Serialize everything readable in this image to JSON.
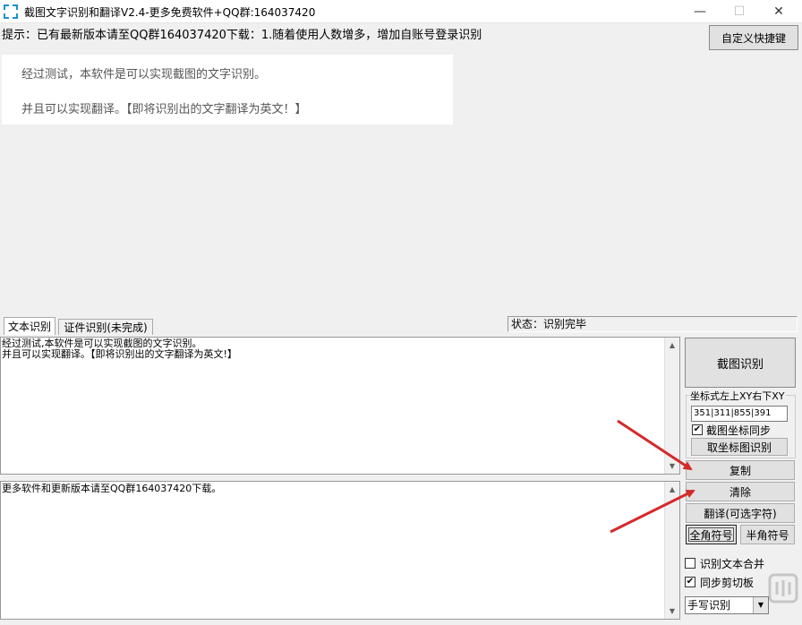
{
  "window": {
    "title": "截图文字识别和翻译V2.4-更多免费软件+QQ群:164037420",
    "min_glyph": "—",
    "max_glyph": "☐",
    "close_glyph": "✕"
  },
  "hint": "提示：已有最新版本请至QQ群164037420下载：1.随着使用人数增多，增加自账号登录识别",
  "shortcut_button": "自定义快捷键",
  "preview": {
    "line1": "经过测试，本软件是可以实现截图的文字识别。",
    "line2": "并且可以实现翻译。【即将识别出的文字翻译为英文！】"
  },
  "tabs": [
    {
      "label": "文本识别"
    },
    {
      "label": "证件识别(未完成)"
    }
  ],
  "status": "状态：识别完毕",
  "ocr_text": {
    "line1": "经过测试,本软件是可以实现截图的文字识别。",
    "line2": "并且可以实现翻译。【即将识别出的文字翻译为英文!】"
  },
  "output_text": "更多软件和更新版本请至QQ群164037420下载。",
  "scroll": {
    "up": "▲",
    "down": "▼"
  },
  "right_panel": {
    "capture_button": "截图识别",
    "coord_label": "坐标式左上XY右下XY",
    "coord_value": "351|311|855|391",
    "sync_label": "截图坐标同步",
    "sync_checked": true,
    "coord_button": "取坐标图识别",
    "copy_button": "复制",
    "clear_button": "清除",
    "translate_button": "翻译(可选字符)",
    "fullwidth_button": "全角符号",
    "halfwidth_button": "半角符号",
    "merge_label": "识别文本合并",
    "merge_checked": false,
    "clipboard_label": "同步剪切板",
    "clipboard_checked": true,
    "mode_value": "手写识别",
    "check_glyph": "✔",
    "dropdown_glyph": "▼"
  },
  "colors": {
    "arrow_red": "#d42a2a",
    "icon_blue": "#1a8fd0"
  }
}
